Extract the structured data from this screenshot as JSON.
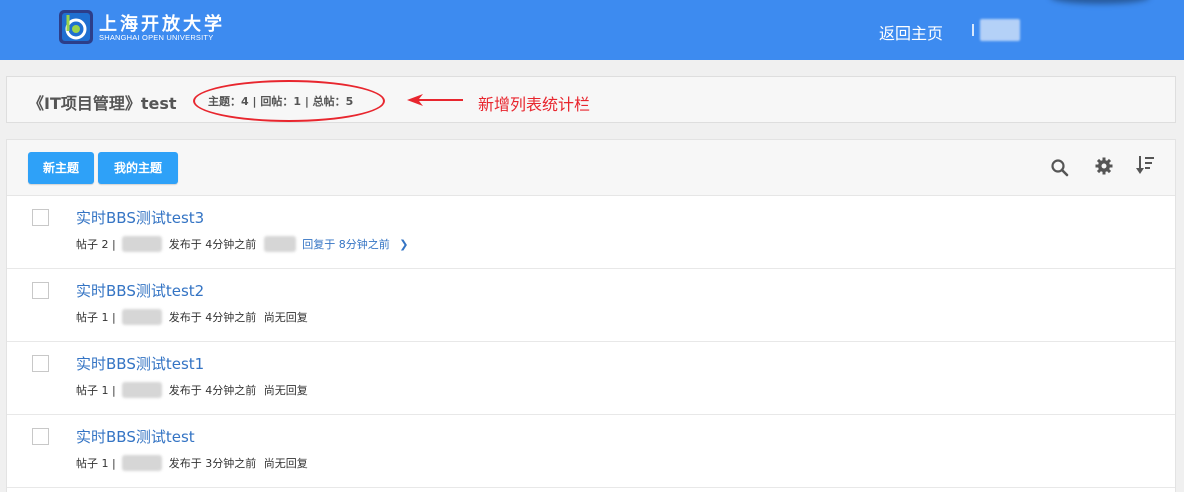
{
  "header": {
    "logo_cn": "上海开放大学",
    "logo_en": "SHANGHAI OPEN UNIVERSITY",
    "home_link": "返回主页",
    "brand_color": "#3d8bf0"
  },
  "forum": {
    "title": "《IT项目管理》test",
    "stats": "主题：4 | 回帖：1 | 总帖：5"
  },
  "annotation": {
    "text": "新增列表统计栏",
    "color": "#e8262e"
  },
  "toolbar": {
    "new_topic": "新主题",
    "my_topics": "我的主题",
    "button_color": "#2ea1f8",
    "icons": [
      "search-icon",
      "gear-icon",
      "sort-icon"
    ]
  },
  "topics": [
    {
      "title": "实时BBS测试test3",
      "posts_prefix": "帖子 2 |",
      "posted": "发布于 4分钟之前",
      "last_reply": "回复于 8分钟之前"
    },
    {
      "title": "实时BBS测试test2",
      "posts_prefix": "帖子 1 |",
      "posted": "发布于 4分钟之前",
      "last_reply": "尚无回复"
    },
    {
      "title": "实时BBS测试test1",
      "posts_prefix": "帖子 1 |",
      "posted": "发布于 4分钟之前",
      "last_reply": "尚无回复"
    },
    {
      "title": "实时BBS测试test",
      "posts_prefix": "帖子 1 |",
      "posted": "发布于 3分钟之前",
      "last_reply": "尚无回复"
    }
  ],
  "link_color": "#3474c4"
}
